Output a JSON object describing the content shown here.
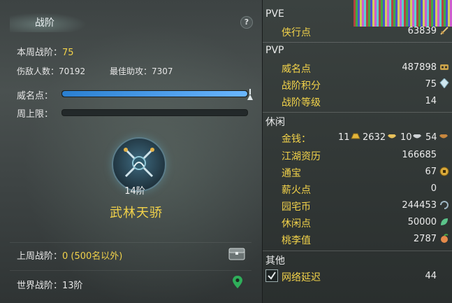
{
  "left": {
    "title": "战阶",
    "help_label": "?",
    "weekly_label": "本周战阶：",
    "weekly_value": "75",
    "kills_label": "伤敌人数：",
    "kills_value": "70192",
    "assist_label": "最佳助攻：",
    "assist_value": "7307",
    "prestige_label": "威名点：",
    "prestige_progress": 1.0,
    "weekly_cap_label": "周上限：",
    "weekly_cap_progress": 0.0,
    "rank_level": "14阶",
    "rank_name": "武林天骄",
    "last_week_label": "上周战阶：",
    "last_week_value": "0 (500名以外)",
    "world_rank_label": "世界战阶：",
    "world_rank_value": "13阶"
  },
  "right": {
    "pve": {
      "header": "PVE",
      "items": [
        {
          "label": "侠行点",
          "value": "63839",
          "icon": "sword-icon"
        }
      ]
    },
    "pvp": {
      "header": "PVP",
      "items": [
        {
          "label": "威名点",
          "value": "487898",
          "icon": "mask-icon"
        },
        {
          "label": "战阶积分",
          "value": "75",
          "icon": "crystal-icon"
        },
        {
          "label": "战阶等级",
          "value": "14",
          "icon": ""
        }
      ]
    },
    "leisure": {
      "header": "休闲",
      "money_label": "金钱：",
      "money_gold": "11",
      "money_silver": "2632",
      "money_copper": "10",
      "money_iron": "54",
      "items": [
        {
          "label": "江湖资历",
          "value": "166685",
          "icon": ""
        },
        {
          "label": "通宝",
          "value": "67",
          "icon": "coin-icon"
        },
        {
          "label": "薪火点",
          "value": "0",
          "icon": ""
        },
        {
          "label": "园宅币",
          "value": "244453",
          "icon": "token-icon"
        },
        {
          "label": "休闲点",
          "value": "50000",
          "icon": "leaf-icon"
        },
        {
          "label": "桃李值",
          "value": "2787",
          "icon": "peach-icon"
        }
      ]
    },
    "other": {
      "header": "其他",
      "items": [
        {
          "label": "网络延迟",
          "value": "44",
          "checked": true
        }
      ]
    }
  }
}
